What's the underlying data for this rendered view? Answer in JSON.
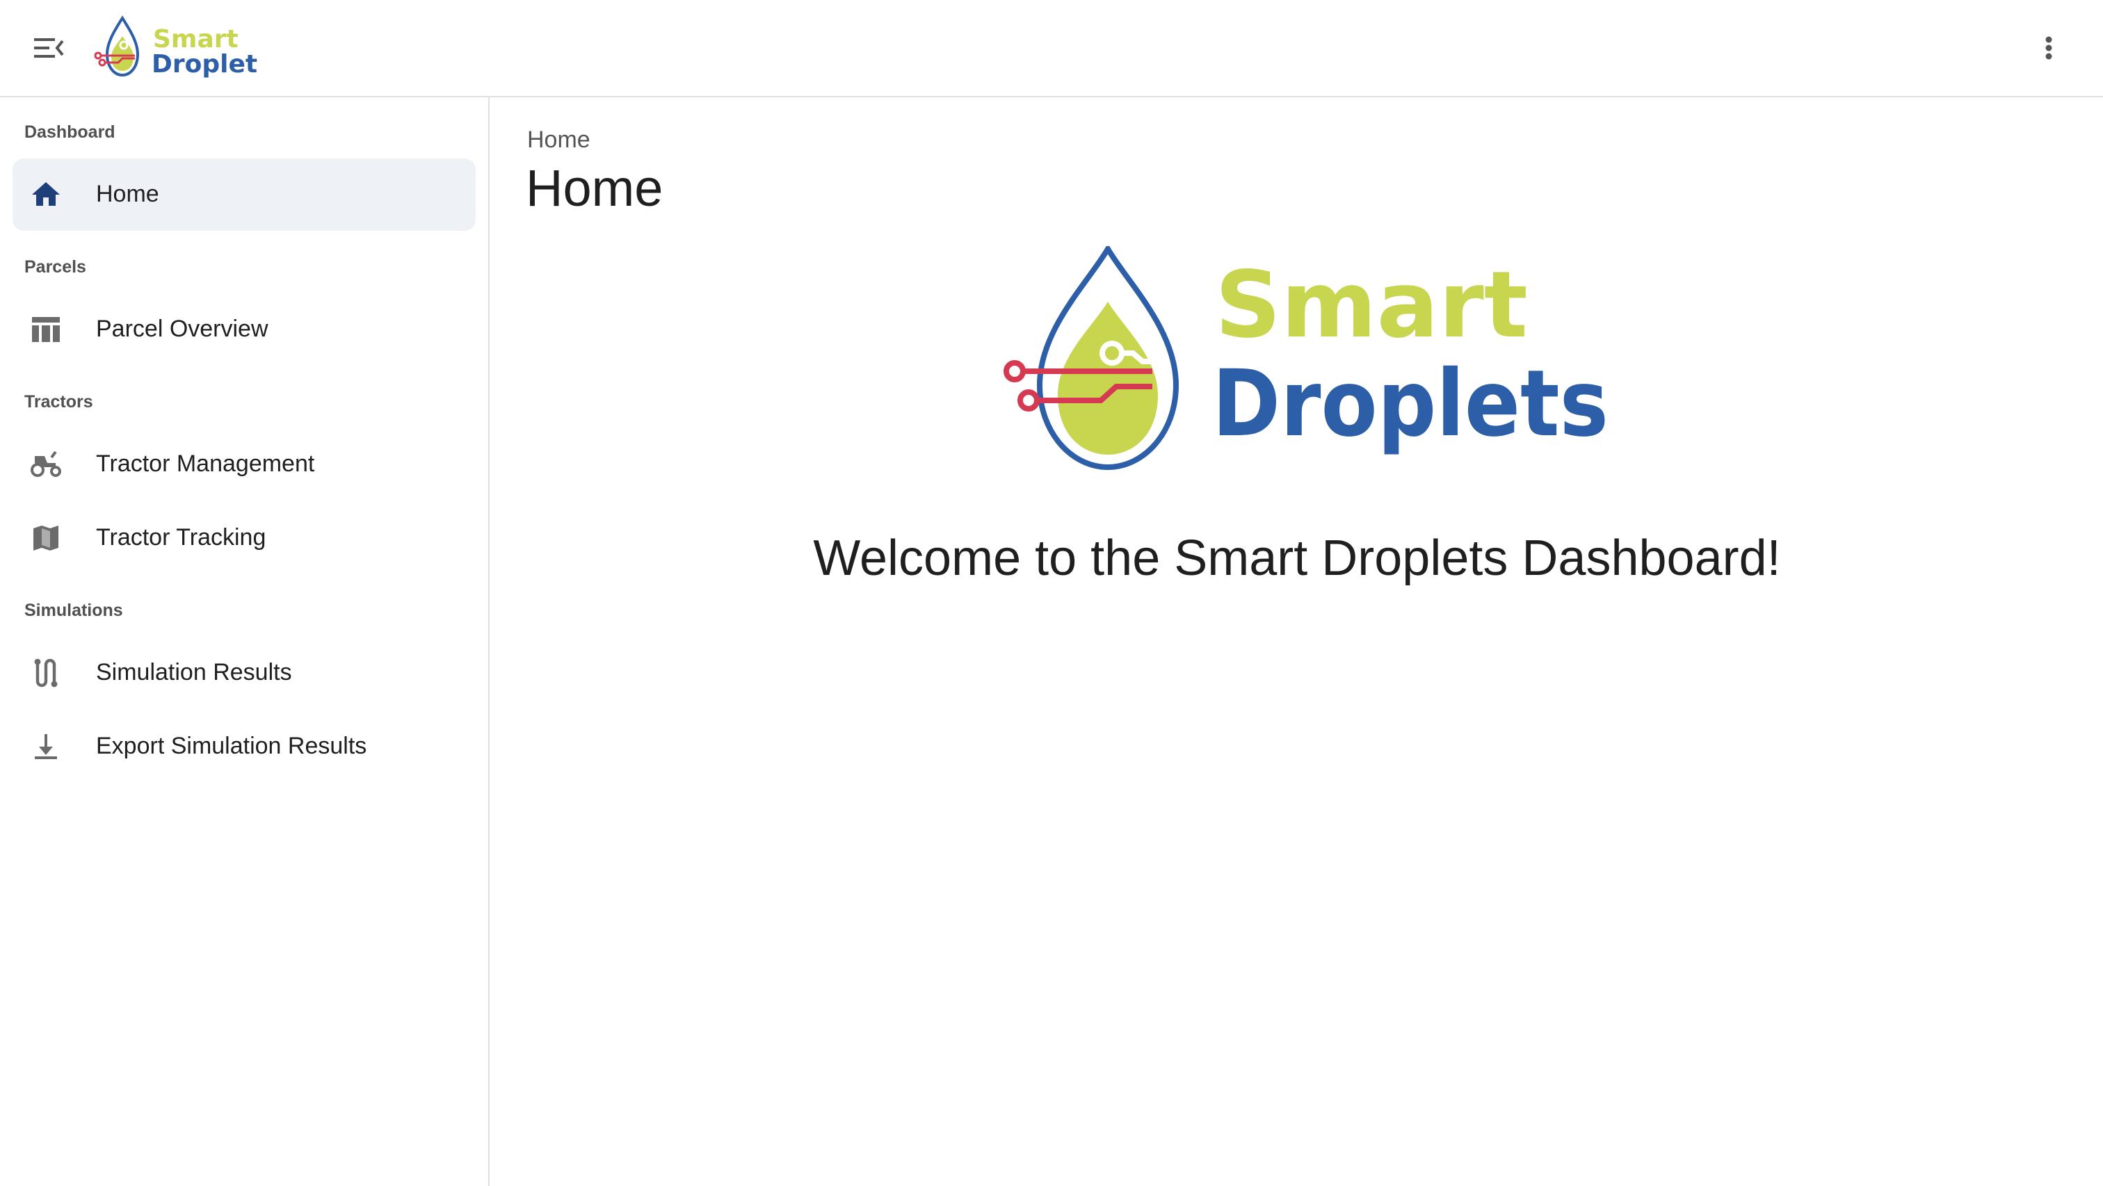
{
  "app": {
    "logo_word1": "Smart",
    "logo_word2": "Droplets"
  },
  "icons": {
    "menu": "menu-collapse-icon",
    "more": "more-vert-icon"
  },
  "colors": {
    "brand_green": "#c8d54f",
    "brand_blue": "#2d5fa8",
    "brand_red": "#d63a52",
    "active_bg": "#eef1f6",
    "active_icon": "#1f3f78",
    "icon_gray": "#6b6b6b"
  },
  "sidebar": {
    "sections": [
      {
        "header": "Dashboard",
        "items": [
          {
            "label": "Home",
            "icon": "home-icon",
            "active": true
          }
        ]
      },
      {
        "header": "Parcels",
        "items": [
          {
            "label": "Parcel Overview",
            "icon": "table-icon",
            "active": false
          }
        ]
      },
      {
        "header": "Tractors",
        "items": [
          {
            "label": "Tractor Management",
            "icon": "tractor-icon",
            "active": false
          },
          {
            "label": "Tractor Tracking",
            "icon": "map-icon",
            "active": false
          }
        ]
      },
      {
        "header": "Simulations",
        "items": [
          {
            "label": "Simulation Results",
            "icon": "route-icon",
            "active": false
          },
          {
            "label": "Export Simulation Results",
            "icon": "download-icon",
            "active": false
          }
        ]
      }
    ]
  },
  "main": {
    "breadcrumb": "Home",
    "title": "Home",
    "welcome": "Welcome to the Smart Droplets Dashboard!"
  }
}
